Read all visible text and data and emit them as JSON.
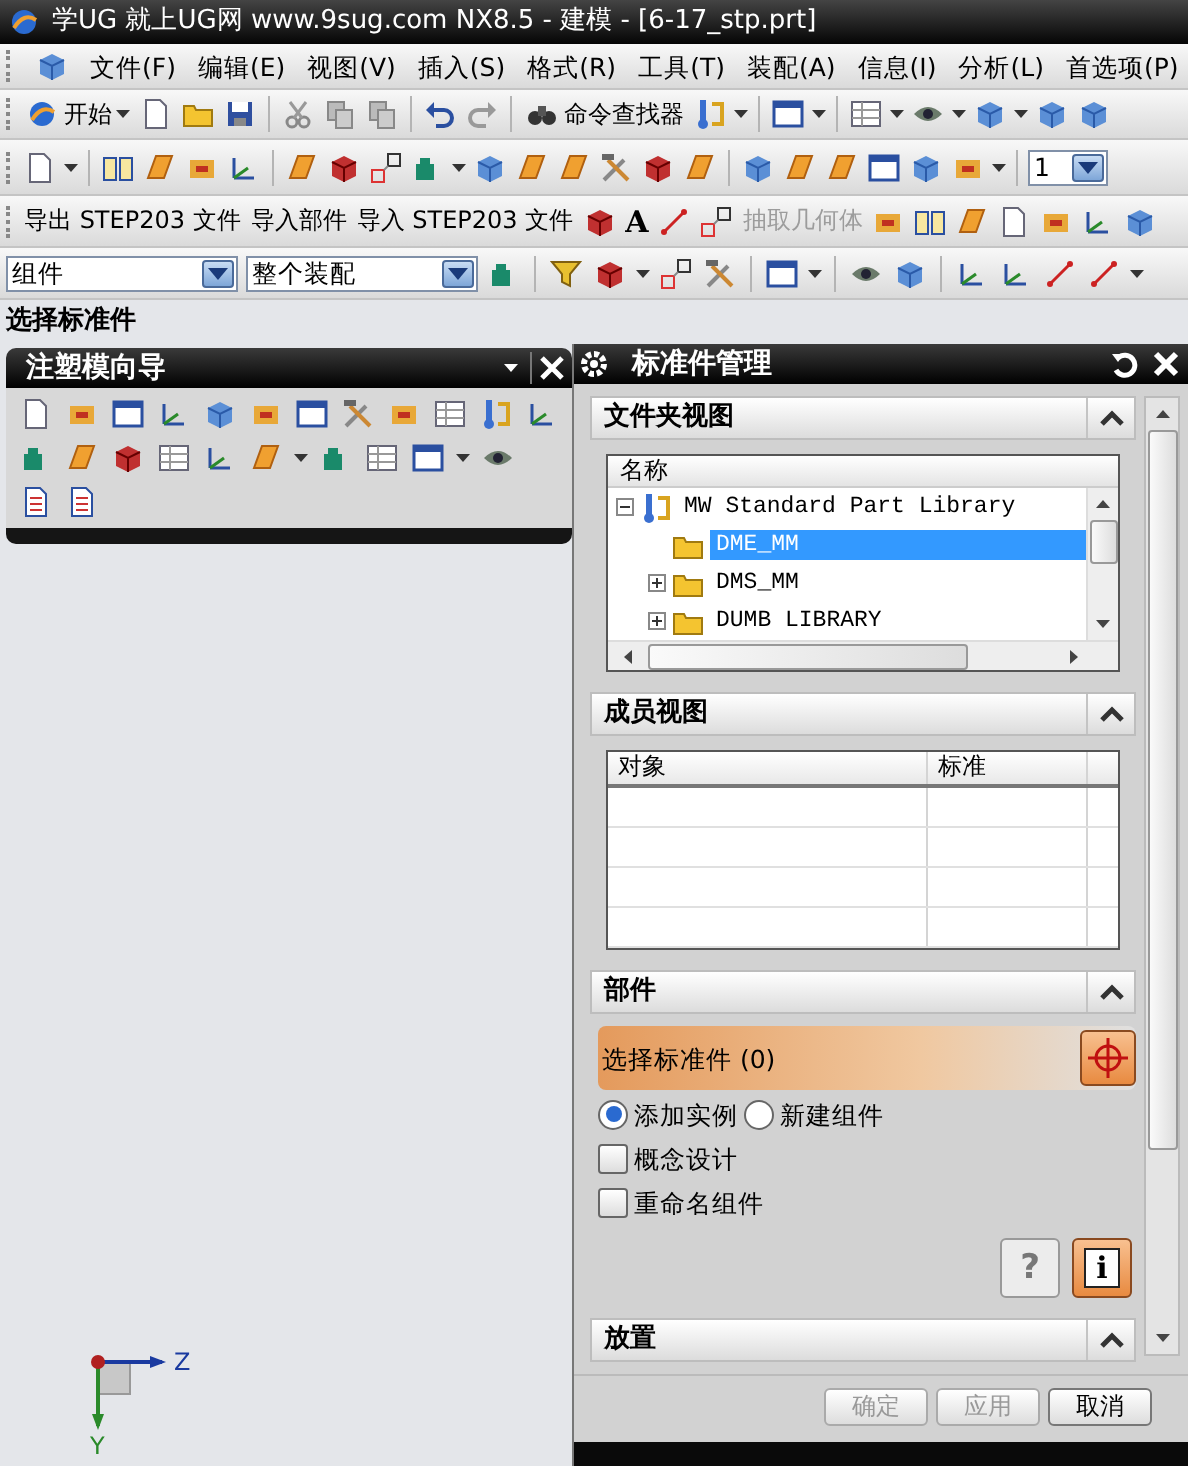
{
  "window": {
    "title": "学UG 就上UG网  www.9sug.com NX8.5 - 建模 - [6-17_stp.prt]"
  },
  "menu": [
    {
      "label": "文件(F)"
    },
    {
      "label": "编辑(E)"
    },
    {
      "label": "视图(V)"
    },
    {
      "label": "插入(S)"
    },
    {
      "label": "格式(R)"
    },
    {
      "label": "工具(T)"
    },
    {
      "label": "装配(A)"
    },
    {
      "label": "信息(I)"
    },
    {
      "label": "分析(L)"
    },
    {
      "label": "首选项(P)"
    }
  ],
  "toolbar_1": [
    {
      "label": "开始",
      "kind": "dropdown"
    },
    {
      "label": "命令查找器",
      "kind": "button"
    }
  ],
  "toolbar_2": {
    "layer_field": "1"
  },
  "toolbar_3": [
    {
      "label": "导出 STEP203 文件",
      "kind": "text",
      "disabled": false
    },
    {
      "label": "导入部件",
      "kind": "text",
      "disabled": false
    },
    {
      "label": "导入 STEP203 文件",
      "kind": "text",
      "disabled": false
    },
    {
      "label": "A",
      "kind": "glyph",
      "disabled": false
    },
    {
      "label": "抽取几何体",
      "kind": "text",
      "disabled": true
    }
  ],
  "selection_bar": {
    "filter": "组件",
    "scope": "整个装配"
  },
  "cue_line": "选择标准件",
  "mold_wizard": {
    "title": "注塑模向导"
  },
  "dialog": {
    "title": "标准件管理",
    "folder_view": {
      "title": "文件夹视图",
      "expanded": true,
      "column": "名称",
      "tree": [
        {
          "label": "MW Standard Part Library",
          "kind": "library",
          "expanded": true,
          "selected": false,
          "children": [
            {
              "label": "DME_MM",
              "kind": "leaf",
              "selected": true
            },
            {
              "label": "DMS_MM",
              "kind": "branch",
              "expanded": false,
              "selected": false
            },
            {
              "label": "DUMB LIBRARY",
              "kind": "branch",
              "expanded": false,
              "selected": false
            }
          ]
        }
      ]
    },
    "member_view": {
      "title": "成员视图",
      "expanded": true,
      "columns": [
        "对象",
        "标准"
      ]
    },
    "part": {
      "title": "部件",
      "expanded": true,
      "select_label": "选择标准件 (0)",
      "options": [
        {
          "label": "添加实例",
          "selected": true
        },
        {
          "label": "新建组件",
          "selected": false
        }
      ],
      "checks": [
        {
          "label": "概念设计",
          "checked": false
        },
        {
          "label": "重命名组件",
          "checked": false
        }
      ],
      "help_glyph": "?",
      "info_glyph": "i"
    },
    "placement": {
      "title": "放置",
      "expanded": true
    },
    "buttons": [
      {
        "label": "确定",
        "disabled": true
      },
      {
        "label": "应用",
        "disabled": true
      },
      {
        "label": "取消",
        "disabled": false
      }
    ]
  },
  "triad": {
    "labels": [
      "Z",
      "Y"
    ]
  }
}
